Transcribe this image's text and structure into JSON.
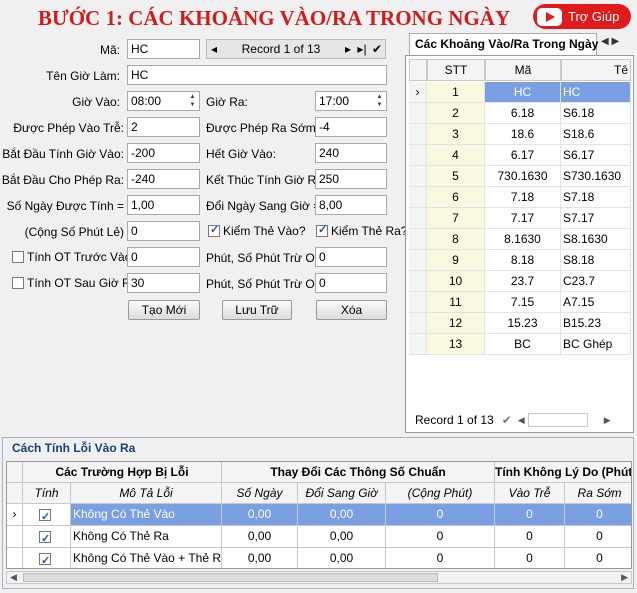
{
  "header": {
    "title": "BƯỚC 1: CÁC KHOẢNG VÀO/RA TRONG NGÀY",
    "help_label": "Trợ Giúp"
  },
  "form": {
    "ma_label": "Mã:",
    "ma_value": "HC",
    "nav_record": "Record 1 of 13",
    "ten_label": "Tên Giờ Làm:",
    "ten_value": "HC",
    "gio_vao_label": "Giờ Vào:",
    "gio_vao_value": "08:00",
    "gio_ra_label": "Giờ Ra:",
    "gio_ra_value": "17:00",
    "vao_tre_label": "Được Phép Vào Trễ:",
    "vao_tre_value": "2",
    "ra_som_label": "Được Phép Ra Sớm:",
    "ra_som_value": "-4",
    "bd_vao_label": "Bắt Đầu Tính Giờ Vào:",
    "bd_vao_value": "-200",
    "het_vao_label": "Hết Giờ Vào:",
    "het_vao_value": "240",
    "bd_ra_label": "Bắt Đầu Cho Phép Ra:",
    "bd_ra_value": "-240",
    "kt_ra_label": "Kết Thúc Tính Giờ Ra:",
    "kt_ra_value": "250",
    "so_ngay_label": "Số Ngày Được Tính =",
    "so_ngay_value": "1,00",
    "doi_ngay_label": "Đổi Ngày Sang Giờ =",
    "doi_ngay_value": "8,00",
    "cong_label": "(Cộng Số Phút Lẻ)",
    "cong_value": "0",
    "kiem_vao_label": "Kiểm Thẻ Vào?",
    "kiem_ra_label": "Kiểm Thẻ Ra?",
    "ot_truoc_label": "Tính OT Trước Vào",
    "ot_truoc_value": "0",
    "phut_tru1_label": "Phút, Số Phút Trừ OT",
    "phut_tru1_value": "0",
    "ot_sau_label": "Tính OT Sau Giờ Ra",
    "ot_sau_value": "30",
    "phut_tru2_label": "Phút, Số Phút Trừ OT",
    "phut_tru2_value": "0",
    "btn_new": "Tạo Mới",
    "btn_save": "Lưu Trữ",
    "btn_delete": "Xóa"
  },
  "right_panel": {
    "tab_label": "Các Khoảng Vào/Ra Trong Ngày",
    "columns": [
      "STT",
      "Mã",
      "Tê"
    ],
    "rows": [
      [
        "1",
        "HC",
        "HC"
      ],
      [
        "2",
        "6.18",
        "S6.18"
      ],
      [
        "3",
        "18.6",
        "S18.6"
      ],
      [
        "4",
        "6.17",
        "S6.17"
      ],
      [
        "5",
        "730.1630",
        "S730.1630"
      ],
      [
        "6",
        "7.18",
        "S7.18"
      ],
      [
        "7",
        "7.17",
        "S7.17"
      ],
      [
        "8",
        "8.1630",
        "S8.1630"
      ],
      [
        "9",
        "8.18",
        "S8.18"
      ],
      [
        "10",
        "23.7",
        "C23.7"
      ],
      [
        "11",
        "7.15",
        "A7.15"
      ],
      [
        "12",
        "15.23",
        "B15.23"
      ],
      [
        "13",
        "BC",
        "BC Ghép"
      ]
    ],
    "footer_record": "Record 1 of 13"
  },
  "bottom_panel": {
    "title": "Cách Tính Lỗi Vào Ra",
    "group_headers": [
      "Các Trường Hợp Bị Lỗi",
      "Thay Đổi Các Thông Số Chuẩn",
      "Tính Không Lý Do (Phút)"
    ],
    "columns": [
      "Tính",
      "Mô Tả Lỗi",
      "Số Ngày",
      "Đổi Sang Giờ",
      "(Cộng Phút)",
      "Vào Trễ",
      "Ra Sớm"
    ],
    "rows": [
      {
        "desc": "Không Có Thẻ Vào",
        "so_ngay": "0,00",
        "doi_gio": "0,00",
        "cong": "0",
        "vao_tre": "0",
        "ra_som": "0"
      },
      {
        "desc": "Không Có Thẻ Ra",
        "so_ngay": "0,00",
        "doi_gio": "0,00",
        "cong": "0",
        "vao_tre": "0",
        "ra_som": "0"
      },
      {
        "desc": "Không Có Thẻ Vào + Thẻ Ra",
        "so_ngay": "0,00",
        "doi_gio": "0,00",
        "cong": "0",
        "vao_tre": "0",
        "ra_som": "0"
      }
    ]
  }
}
